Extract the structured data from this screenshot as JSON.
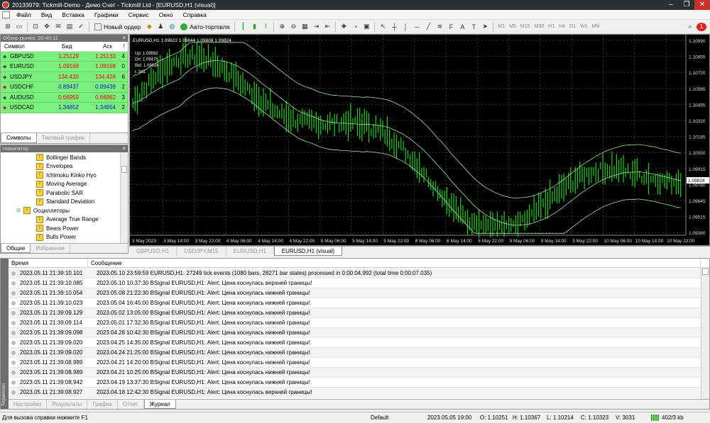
{
  "window": {
    "title": "20133979: Tickmill-Demo - Демо Счет - Tickmill Ltd - [EURUSD,H1 (visual)]",
    "min": "–",
    "max": "❐",
    "close": "✕"
  },
  "menu": [
    "Файл",
    "Вид",
    "Вставка",
    "Графики",
    "Сервис",
    "Окно",
    "Справка"
  ],
  "toolbar": {
    "new_order": "Новый ордер",
    "autotrading": "Авто-торговля",
    "timeframes": [
      "M1",
      "M5",
      "M15",
      "M30",
      "H1",
      "H4",
      "D1",
      "W1",
      "MN"
    ]
  },
  "market_watch": {
    "title": "Обзор рынка: 20:40:11",
    "col_symbol": "Символ",
    "col_bid": "Бид",
    "col_ask": "Аск",
    "col_spread": "!",
    "rows": [
      {
        "sym": "GBPUSD",
        "bid": "1.25129",
        "ask": "1.25133",
        "spr": "4",
        "dir": "up",
        "color": "red"
      },
      {
        "sym": "EURUSD",
        "bid": "1.09168",
        "ask": "1.09168",
        "spr": "0",
        "dir": "up",
        "color": "red"
      },
      {
        "sym": "USDJPY",
        "bid": "134.420",
        "ask": "134.426",
        "spr": "6",
        "dir": "up",
        "color": "red"
      },
      {
        "sym": "USDCHF",
        "bid": "0.89437",
        "ask": "0.89439",
        "spr": "2",
        "dir": "dn",
        "color": "blue"
      },
      {
        "sym": "AUDUSD",
        "bid": "0.66959",
        "ask": "0.66962",
        "spr": "3",
        "dir": "up",
        "color": "red"
      },
      {
        "sym": "USDCAD",
        "bid": "1.34852",
        "ask": "1.34854",
        "spr": "2",
        "dir": "dn",
        "color": "blue"
      }
    ],
    "tabs": [
      "Символы",
      "Тиковый график"
    ]
  },
  "navigator": {
    "title": "Навигатор",
    "items": [
      {
        "label": "Bollinger Bands",
        "level": 2
      },
      {
        "label": "Envelopes",
        "level": 2
      },
      {
        "label": "Ichimoku Kinko Hyo",
        "level": 2
      },
      {
        "label": "Moving Average",
        "level": 2
      },
      {
        "label": "Parabolic SAR",
        "level": 2
      },
      {
        "label": "Standard Deviation",
        "level": 2
      },
      {
        "label": "Осцилляторы",
        "level": 1
      },
      {
        "label": "Average True Range",
        "level": 2
      },
      {
        "label": "Bears Power",
        "level": 2
      },
      {
        "label": "Bulls Power",
        "level": 2
      }
    ],
    "tabs": [
      "Общие",
      "Избранное"
    ]
  },
  "chart": {
    "header": "EURUSD,H1  1.09822 1.09844 1.09808 1.09824",
    "info": [
      "Up: 1.09932",
      "Dn: 1.09475",
      "Bid: 1.09824",
      "i: 342"
    ],
    "price_labels": [
      "1.10990",
      "1.10855",
      "1.10720",
      "1.10585",
      "1.10455",
      "1.10320",
      "1.10185",
      "1.10050",
      "1.09915",
      "1.09780",
      "1.09645",
      "1.09515",
      "1.09380"
    ],
    "current_price": "1.09824",
    "time_labels": [
      "3 May 2023",
      "3 May 14:00",
      "3 May 22:00",
      "4 May 06:00",
      "4 May 14:00",
      "4 May 22:00",
      "5 May 06:00",
      "5 May 14:00",
      "5 May 22:00",
      "8 May 06:00",
      "8 May 14:00",
      "8 May 22:00",
      "9 May 06:00",
      "9 May 14:00",
      "9 May 22:00",
      "10 May 06:00",
      "10 May 14:00",
      "10 May 22:00"
    ],
    "tabs": [
      "GBPUSD,H1",
      "USDJPY,M15",
      "EURUSD,H1",
      "EURUSD,H1 (visual)"
    ],
    "active_tab": 3
  },
  "terminal": {
    "side_label": "Терминал",
    "col_time": "Время",
    "col_msg": "Сообщение",
    "rows": [
      {
        "t": "2023.05.11 21:39:10.101",
        "m": "2023.05.10 23:59:59  EURUSD,H1: 27249 tick events (1080 bars, 28271 bar states) processed in 0:00:04.992 (total time 0:00:07.035)"
      },
      {
        "t": "2023.05.11 21:39:10.085",
        "m": "2023.05.10 10:37:30  BSignal EURUSD,H1: Alert: Цена коснулась верхней границы!"
      },
      {
        "t": "2023.05.11 21:39:10.054",
        "m": "2023.05.08 21:22:30  BSignal EURUSD,H1: Alert: Цена коснулась нижней границы!"
      },
      {
        "t": "2023.05.11 21:39:10.023",
        "m": "2023.05.04 16:45:00  BSignal EURUSD,H1: Alert: Цена коснулась нижней границы!"
      },
      {
        "t": "2023.05.11 21:39:09.129",
        "m": "2023.05.02 13:05:00  BSignal EURUSD,H1: Alert: Цена коснулась нижней границы!"
      },
      {
        "t": "2023.05.11 21:39:09.114",
        "m": "2023.05.01 17:32:30  BSignal EURUSD,H1: Alert: Цена коснулась нижней границы!"
      },
      {
        "t": "2023.05.11 21:39:09.098",
        "m": "2023.04.28 10:42:30  BSignal EURUSD,H1: Alert: Цена коснулась нижней границы!"
      },
      {
        "t": "2023.05.11 21:39:09.020",
        "m": "2023.04.25 14:35:00  BSignal EURUSD,H1: Alert: Цена коснулась нижней границы!"
      },
      {
        "t": "2023.05.11 21:39:09.020",
        "m": "2023.04.24 21:25:00  BSignal EURUSD,H1: Alert: Цена коснулась нижней границы!"
      },
      {
        "t": "2023.05.11 21:39:08.989",
        "m": "2023.04.21 14:20:00  BSignal EURUSD,H1: Alert: Цена коснулась нижней границы!"
      },
      {
        "t": "2023.05.11 21:39:08.989",
        "m": "2023.04.21 10:25:00  BSignal EURUSD,H1: Alert: Цена коснулась нижней границы!"
      },
      {
        "t": "2023.05.11 21:39:08.942",
        "m": "2023.04.19 13:37:30  BSignal EURUSD,H1: Alert: Цена коснулась нижней границы!"
      },
      {
        "t": "2023.05.11 21:39:08.927",
        "m": "2023.04.18 12:42:30  BSignal EURUSD,H1: Alert: Цена коснулась верхней границы!"
      }
    ],
    "tabs": [
      "Настройки",
      "Результаты",
      "График",
      "Отчет",
      "Журнал"
    ],
    "active_tab": 4
  },
  "status": {
    "help": "Для вызова справки нажмите F1",
    "profile": "Default",
    "datetime": "2023.05.05 19:00",
    "open": "O: 1.10251",
    "high": "H: 1.10367",
    "low": "L: 1.10214",
    "close": "C: 1.10323",
    "volume": "V: 3031",
    "traffic": "402/3 kb"
  }
}
